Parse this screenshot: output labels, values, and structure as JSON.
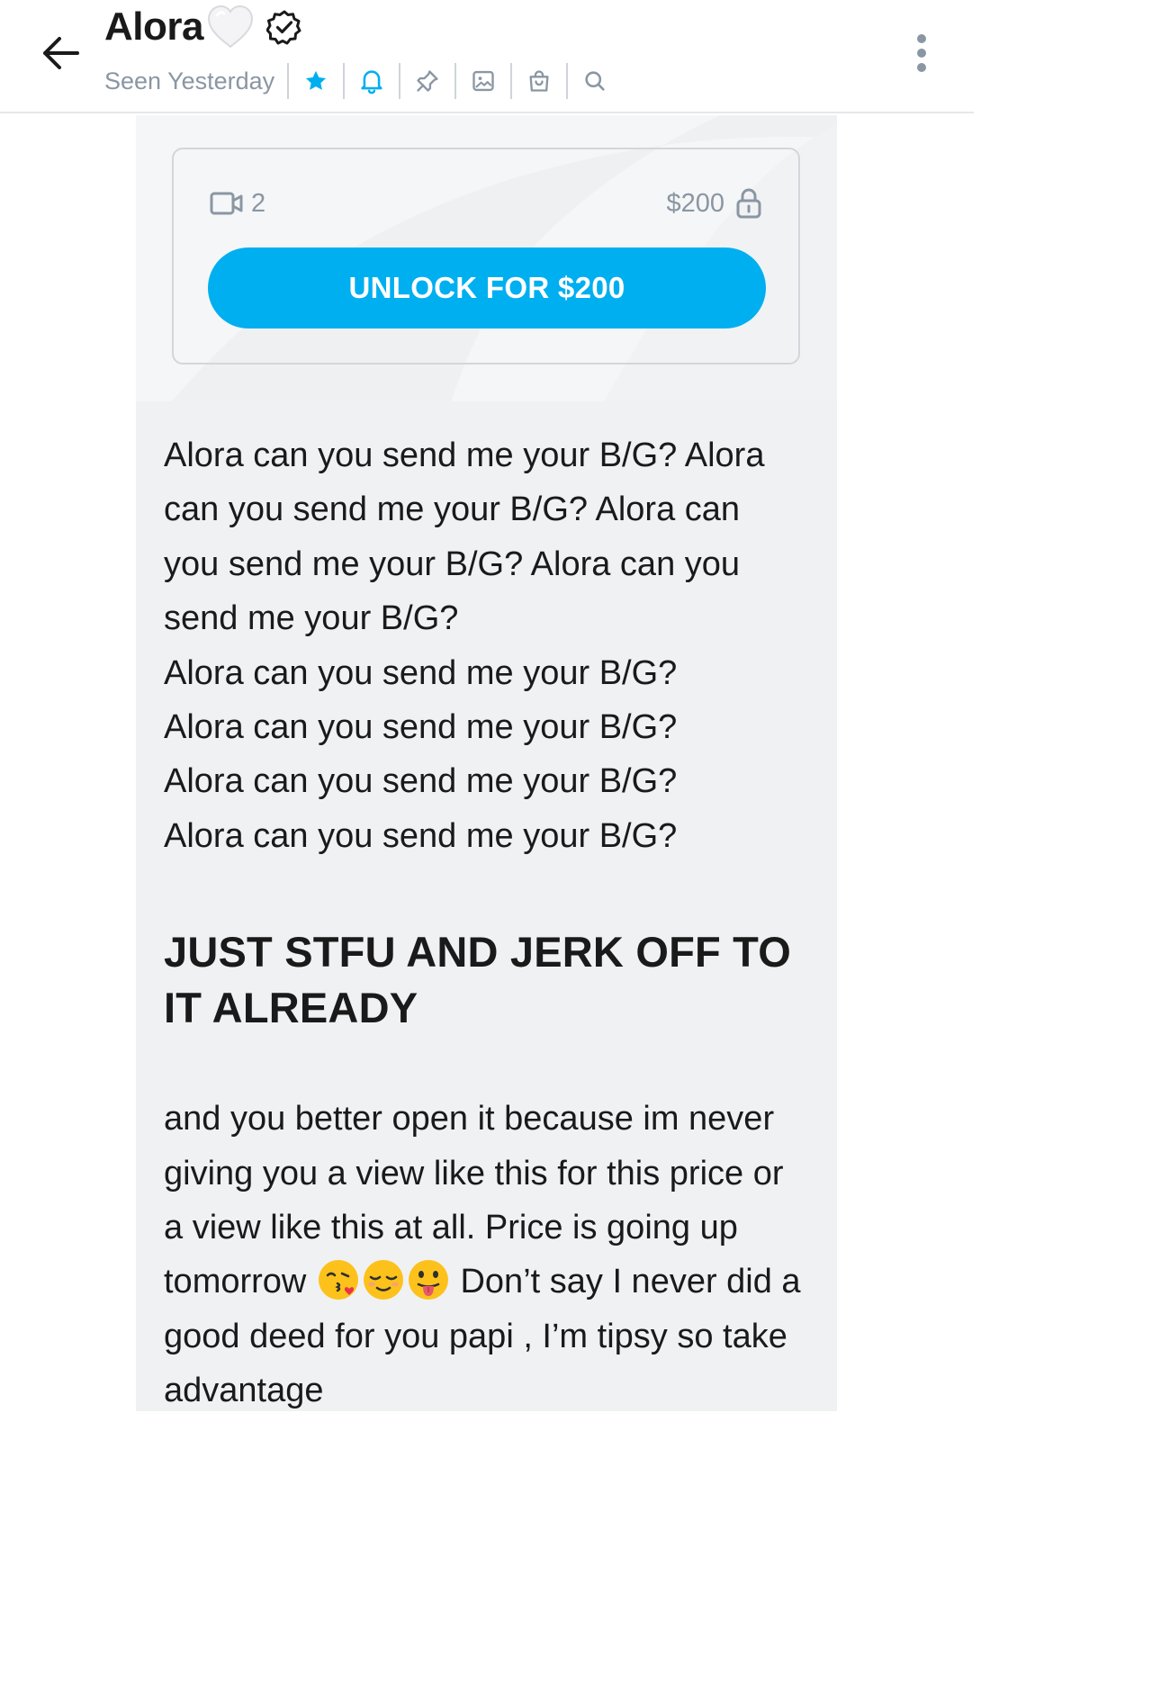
{
  "header": {
    "name": "Alora",
    "heart_emoji": "🤍",
    "seen_status": "Seen Yesterday",
    "tools": [
      "star-icon",
      "bell-icon",
      "pin-icon",
      "image-icon",
      "bag-icon",
      "search-icon"
    ],
    "accent_color": "#00aff0"
  },
  "locked_message": {
    "video_count": "2",
    "price": "$200",
    "unlock_label": "UNLOCK FOR $200"
  },
  "message": {
    "paragraph1": "Alora can you send me your B/G? Alora can you send me your B/G? Alora can you send me your B/G? Alora can you send me your B/G?",
    "lines": [
      "Alora can you send me your B/G?",
      "Alora can you send me your B/G?",
      "Alora can you send me your B/G?",
      "Alora can you send me your B/G?"
    ],
    "shout": "JUST STFU AND JERK OFF TO IT ALREADY",
    "closing_before_emoji": "and you better open it because im never giving you a view like this for this price or a view like this at all. Price is going up tomorrow ",
    "emojis": [
      "😘",
      "😌",
      "😛"
    ],
    "closing_after_emoji": " Don’t say I never did a good deed for you papi , I’m tipsy so take advantage"
  }
}
